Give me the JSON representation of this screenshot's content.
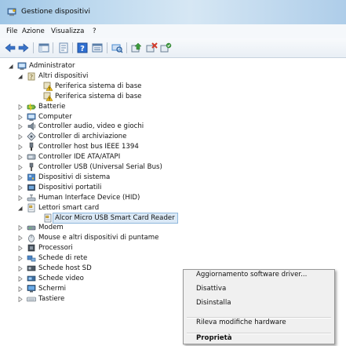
{
  "window": {
    "title": "Gestione dispositivi"
  },
  "menubar": {
    "items": [
      "File",
      "Azione",
      "Visualizza",
      "?"
    ]
  },
  "toolbar": {
    "buttons": [
      {
        "icon": "back-arrow-icon",
        "color": "#3a73c8"
      },
      {
        "icon": "forward-arrow-icon",
        "color": "#3a73c8"
      },
      {
        "icon": "console-tree-icon",
        "color": "#5a7ea8"
      },
      {
        "icon": "properties-icon",
        "color": "#6b8bb0"
      },
      {
        "icon": "help-icon",
        "color": "#2f6fd1"
      },
      {
        "icon": "view-icon",
        "color": "#5a7ea8"
      },
      {
        "icon": "scan-hardware-icon",
        "color": "#4a8bd1"
      },
      {
        "icon": "update-driver-icon",
        "color": "#3c9a3c"
      },
      {
        "icon": "uninstall-icon",
        "color": "#d23a2a"
      },
      {
        "icon": "disable-icon",
        "color": "#3c9a3c"
      }
    ]
  },
  "tree": {
    "nodes": [
      {
        "label": "Administrator",
        "icon": "computer-icon",
        "level": 0,
        "state": "expanded"
      },
      {
        "label": "Altri dispositivi",
        "icon": "unknown-device-icon",
        "level": 1,
        "state": "expanded"
      },
      {
        "label": "Periferica sistema di base",
        "icon": "warning-device-icon",
        "level": 2,
        "state": "leaf"
      },
      {
        "label": "Periferica sistema di base",
        "icon": "warning-device-icon",
        "level": 2,
        "state": "leaf"
      },
      {
        "label": "Batterie",
        "icon": "battery-icon",
        "level": 1,
        "state": "collapsed"
      },
      {
        "label": "Computer",
        "icon": "computer-icon",
        "level": 1,
        "state": "collapsed"
      },
      {
        "label": "Controller audio, video e giochi",
        "icon": "speaker-icon",
        "level": 1,
        "state": "collapsed"
      },
      {
        "label": "Controller di archiviazione",
        "icon": "storage-icon",
        "level": 1,
        "state": "collapsed"
      },
      {
        "label": "Controller host bus IEEE 1394",
        "icon": "firewire-icon",
        "level": 1,
        "state": "collapsed"
      },
      {
        "label": "Controller IDE ATA/ATAPI",
        "icon": "ide-icon",
        "level": 1,
        "state": "collapsed"
      },
      {
        "label": "Controller USB (Universal Serial Bus)",
        "icon": "usb-icon",
        "level": 1,
        "state": "collapsed"
      },
      {
        "label": "Dispositivi di sistema",
        "icon": "system-device-icon",
        "level": 1,
        "state": "collapsed"
      },
      {
        "label": "Dispositivi portatili",
        "icon": "portable-device-icon",
        "level": 1,
        "state": "collapsed"
      },
      {
        "label": "Human Interface Device (HID)",
        "icon": "hid-icon",
        "level": 1,
        "state": "collapsed"
      },
      {
        "label": "Lettori smart card",
        "icon": "smartcard-icon",
        "level": 1,
        "state": "expanded"
      },
      {
        "label": "Alcor Micro USB Smart Card Reader",
        "icon": "smartcard-icon",
        "level": 2,
        "state": "leaf",
        "selected": true
      },
      {
        "label": "Modem",
        "icon": "modem-icon",
        "level": 1,
        "state": "collapsed"
      },
      {
        "label": "Mouse e altri dispositivi di puntame",
        "icon": "mouse-icon",
        "level": 1,
        "state": "collapsed"
      },
      {
        "label": "Processori",
        "icon": "processor-icon",
        "level": 1,
        "state": "collapsed"
      },
      {
        "label": "Schede di rete",
        "icon": "network-icon",
        "level": 1,
        "state": "collapsed"
      },
      {
        "label": "Schede host SD",
        "icon": "sd-host-icon",
        "level": 1,
        "state": "collapsed"
      },
      {
        "label": "Schede video",
        "icon": "display-adapter-icon",
        "level": 1,
        "state": "collapsed"
      },
      {
        "label": "Schermi",
        "icon": "monitor-icon",
        "level": 1,
        "state": "collapsed"
      },
      {
        "label": "Tastiere",
        "icon": "keyboard-icon",
        "level": 1,
        "state": "collapsed"
      }
    ]
  },
  "context_menu": {
    "items": [
      {
        "label": "Aggiornamento software driver...",
        "bold": false
      },
      {
        "label": "Disattiva",
        "bold": false
      },
      {
        "label": "Disinstalla",
        "bold": false
      },
      {
        "separator": true
      },
      {
        "label": "Rileva modifiche hardware",
        "bold": false
      },
      {
        "separator": true
      },
      {
        "label": "Proprietà",
        "bold": true
      }
    ]
  },
  "colors": {
    "selection_bg": "#dbe9f6",
    "selection_border": "#8fb8dd",
    "titlebar": "#bcd8ee"
  }
}
